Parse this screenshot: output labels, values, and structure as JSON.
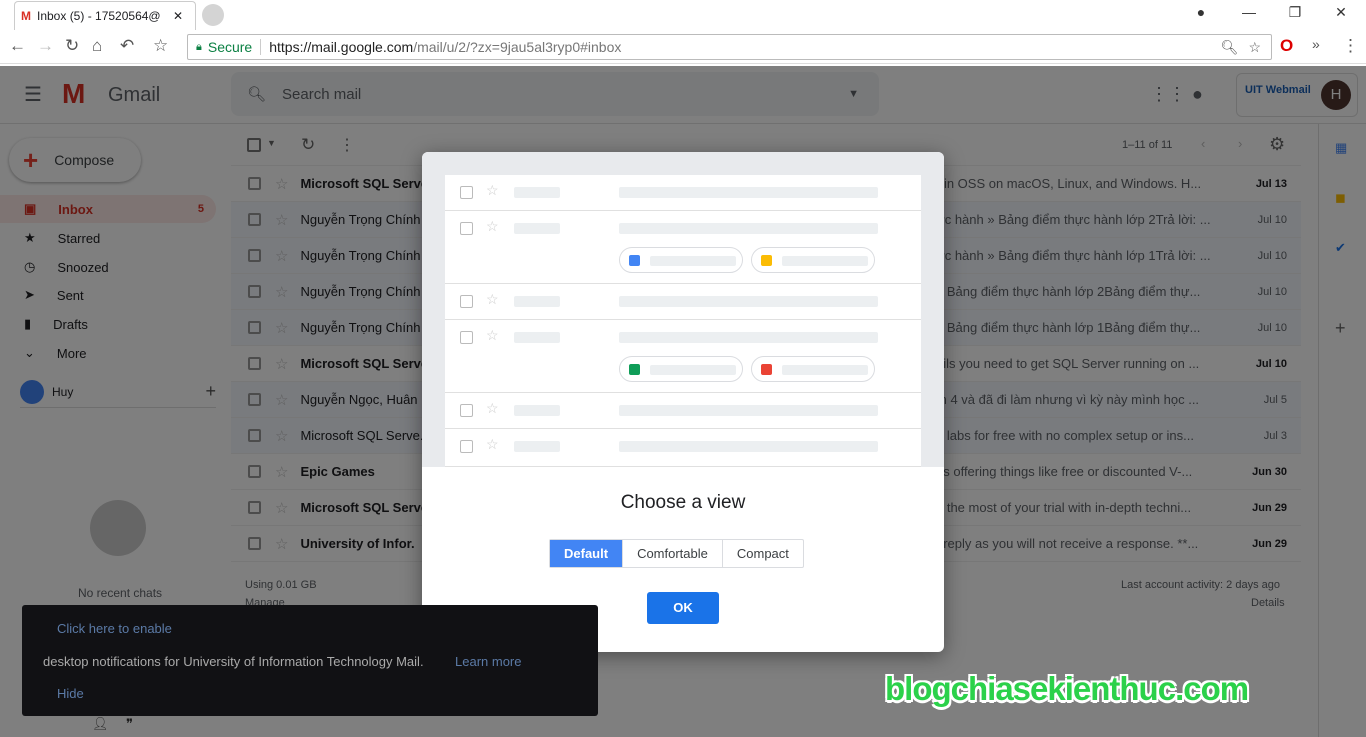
{
  "browser": {
    "tab_title": "Inbox (5) - 17520564@",
    "secure_label": "Secure",
    "url_host": "https://mail.google.com",
    "url_path": "/mail/u/2/?zx=9jau5al3ryp0#inbox"
  },
  "header": {
    "app_name": "Gmail",
    "search_placeholder": "Search mail",
    "org_logo": "UIT Webmail",
    "avatar_letter": "H"
  },
  "toolbar": {
    "pagination": "1–11 of 11"
  },
  "sidebar": {
    "compose": "Compose",
    "items": [
      {
        "label": "Inbox",
        "count": "5",
        "icon": "inbox-icon"
      },
      {
        "label": "Starred",
        "icon": "star-icon"
      },
      {
        "label": "Snoozed",
        "icon": "clock-icon"
      },
      {
        "label": "Sent",
        "icon": "send-icon"
      },
      {
        "label": "Drafts",
        "icon": "draft-icon"
      },
      {
        "label": "More",
        "icon": "chevron-down-icon"
      }
    ],
    "user": "Huy",
    "no_chats": "No recent chats"
  },
  "emails": [
    {
      "from": "Microsoft SQL Serve.",
      "snippet": "r in OSS on macOS, Linux, and Windows. H...",
      "date": "Jul 13",
      "unread": true
    },
    {
      "from": "Nguyễn Trọng Chính",
      "snippet": "ực hành » Bảng điểm thực hành lớp 2Trả lời: ...",
      "date": "Jul 10",
      "unread": false
    },
    {
      "from": "Nguyễn Trọng Chính",
      "snippet": "ực hành » Bảng điểm thực hành lớp 1Trả lời: ...",
      "date": "Jul 10",
      "unread": false
    },
    {
      "from": "Nguyễn Trọng Chính",
      "snippet": "» Bảng điểm thực hành lớp 2Bảng điểm thự...",
      "date": "Jul 10",
      "unread": false
    },
    {
      "from": "Nguyễn Trọng Chính",
      "snippet": "» Bảng điểm thực hành lớp 1Bảng điểm thự...",
      "date": "Jul 10",
      "unread": false
    },
    {
      "from": "Microsoft SQL Serve.",
      "snippet": "ails you need to get SQL Server running on ...",
      "date": "Jul 10",
      "unread": true
    },
    {
      "from": "Nguyễn Ngọc, Huân",
      "snippet": "m 4 và đã đi làm nhưng vì kỳ này mình học ...",
      "date": "Jul 5",
      "unread": false
    },
    {
      "from": "Microsoft SQL Serve.",
      "snippet": "e labs for free with no complex setup or ins...",
      "date": "Jul 3",
      "unread": false
    },
    {
      "from": "Epic Games",
      "snippet": "es offering things like free or discounted V-...",
      "date": "Jun 30",
      "unread": true
    },
    {
      "from": "Microsoft SQL Serve.",
      "snippet": "e the most of your trial with in-depth techni...",
      "date": "Jun 29",
      "unread": true
    },
    {
      "from": "University of Infor.",
      "snippet": "t reply as you will not receive a response. **...",
      "date": "Jun 29",
      "unread": true
    }
  ],
  "footer": {
    "storage": "Using 0.01 GB",
    "manage": "Manage",
    "activity": "Last account activity: 2 days ago",
    "details": "Details"
  },
  "modal": {
    "title": "Choose a view",
    "options": [
      "Default",
      "Comfortable",
      "Compact"
    ],
    "selected": "Default",
    "ok": "OK"
  },
  "notification": {
    "enable": "Click here to enable",
    "message": "desktop notifications for University of Information Technology Mail.",
    "learn_more": "Learn more",
    "hide": "Hide"
  },
  "watermark": "blogchiasekienthuc.com"
}
